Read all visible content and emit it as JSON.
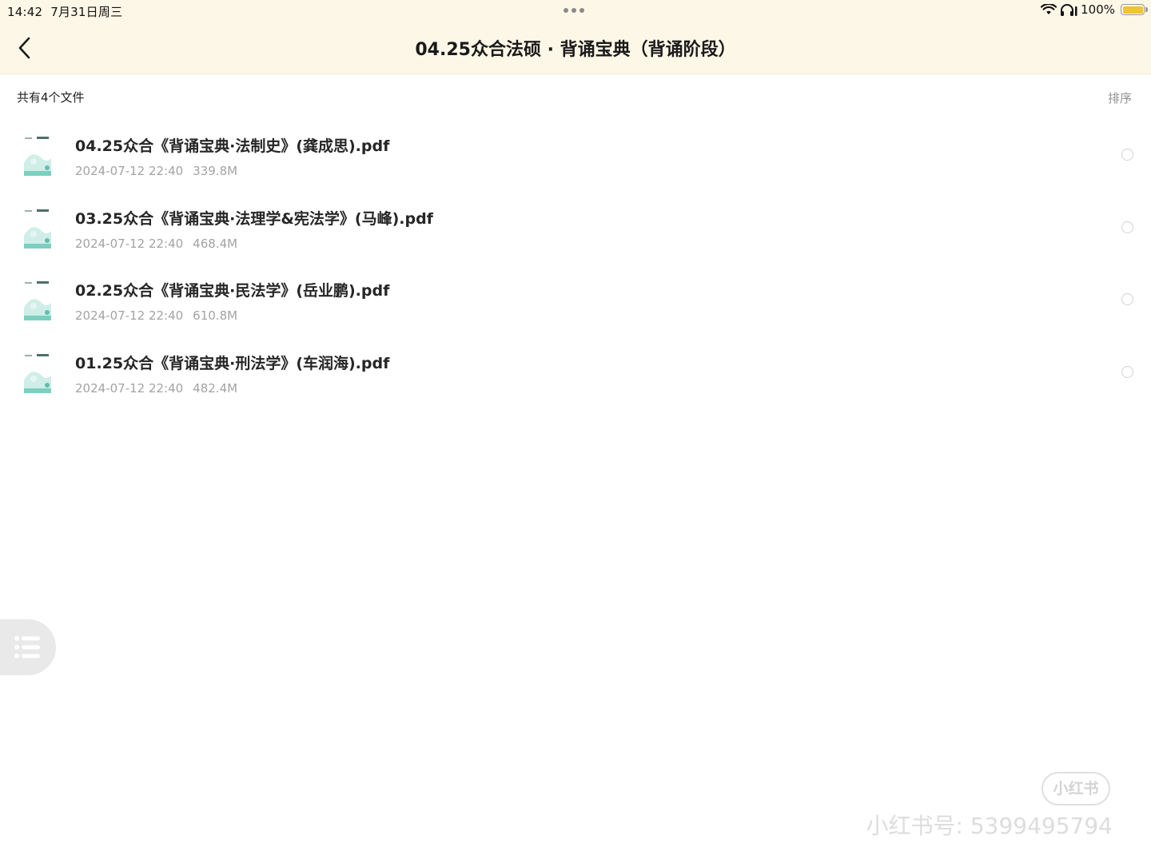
{
  "status_bar": {
    "time": "14:42",
    "date": "7月31日周三",
    "battery_text": "100%"
  },
  "header": {
    "title": "04.25众合法硕 · 背诵宝典（背诵阶段）",
    "background_color": "#fdf7e7"
  },
  "list_header": {
    "count_label": "共有4个文件",
    "sort_label": "排序"
  },
  "files": [
    {
      "name": "04.25众合《背诵宝典·法制史》(龚成思).pdf",
      "date": "2024-07-12 22:40",
      "size": "339.8M"
    },
    {
      "name": "03.25众合《背诵宝典·法理学&宪法学》(马峰).pdf",
      "date": "2024-07-12 22:40",
      "size": "468.4M"
    },
    {
      "name": "02.25众合《背诵宝典·民法学》(岳业鹏).pdf",
      "date": "2024-07-12 22:40",
      "size": "610.8M"
    },
    {
      "name": "01.25众合《背诵宝典·刑法学》(车润海).pdf",
      "date": "2024-07-12 22:40",
      "size": "482.4M"
    }
  ],
  "watermark": {
    "badge": "小红书",
    "text": "小红书号: 5399495794"
  },
  "icons": {
    "back": "chevron-left-icon",
    "menu": "list-menu-icon",
    "wifi": "wifi-icon",
    "headphones": "headphones-icon",
    "battery": "battery-icon",
    "file_thumb": "pdf-cover-thumbnail"
  },
  "colors": {
    "accent_teal": "#7ccfc0",
    "battery_fill": "#f0c330"
  }
}
